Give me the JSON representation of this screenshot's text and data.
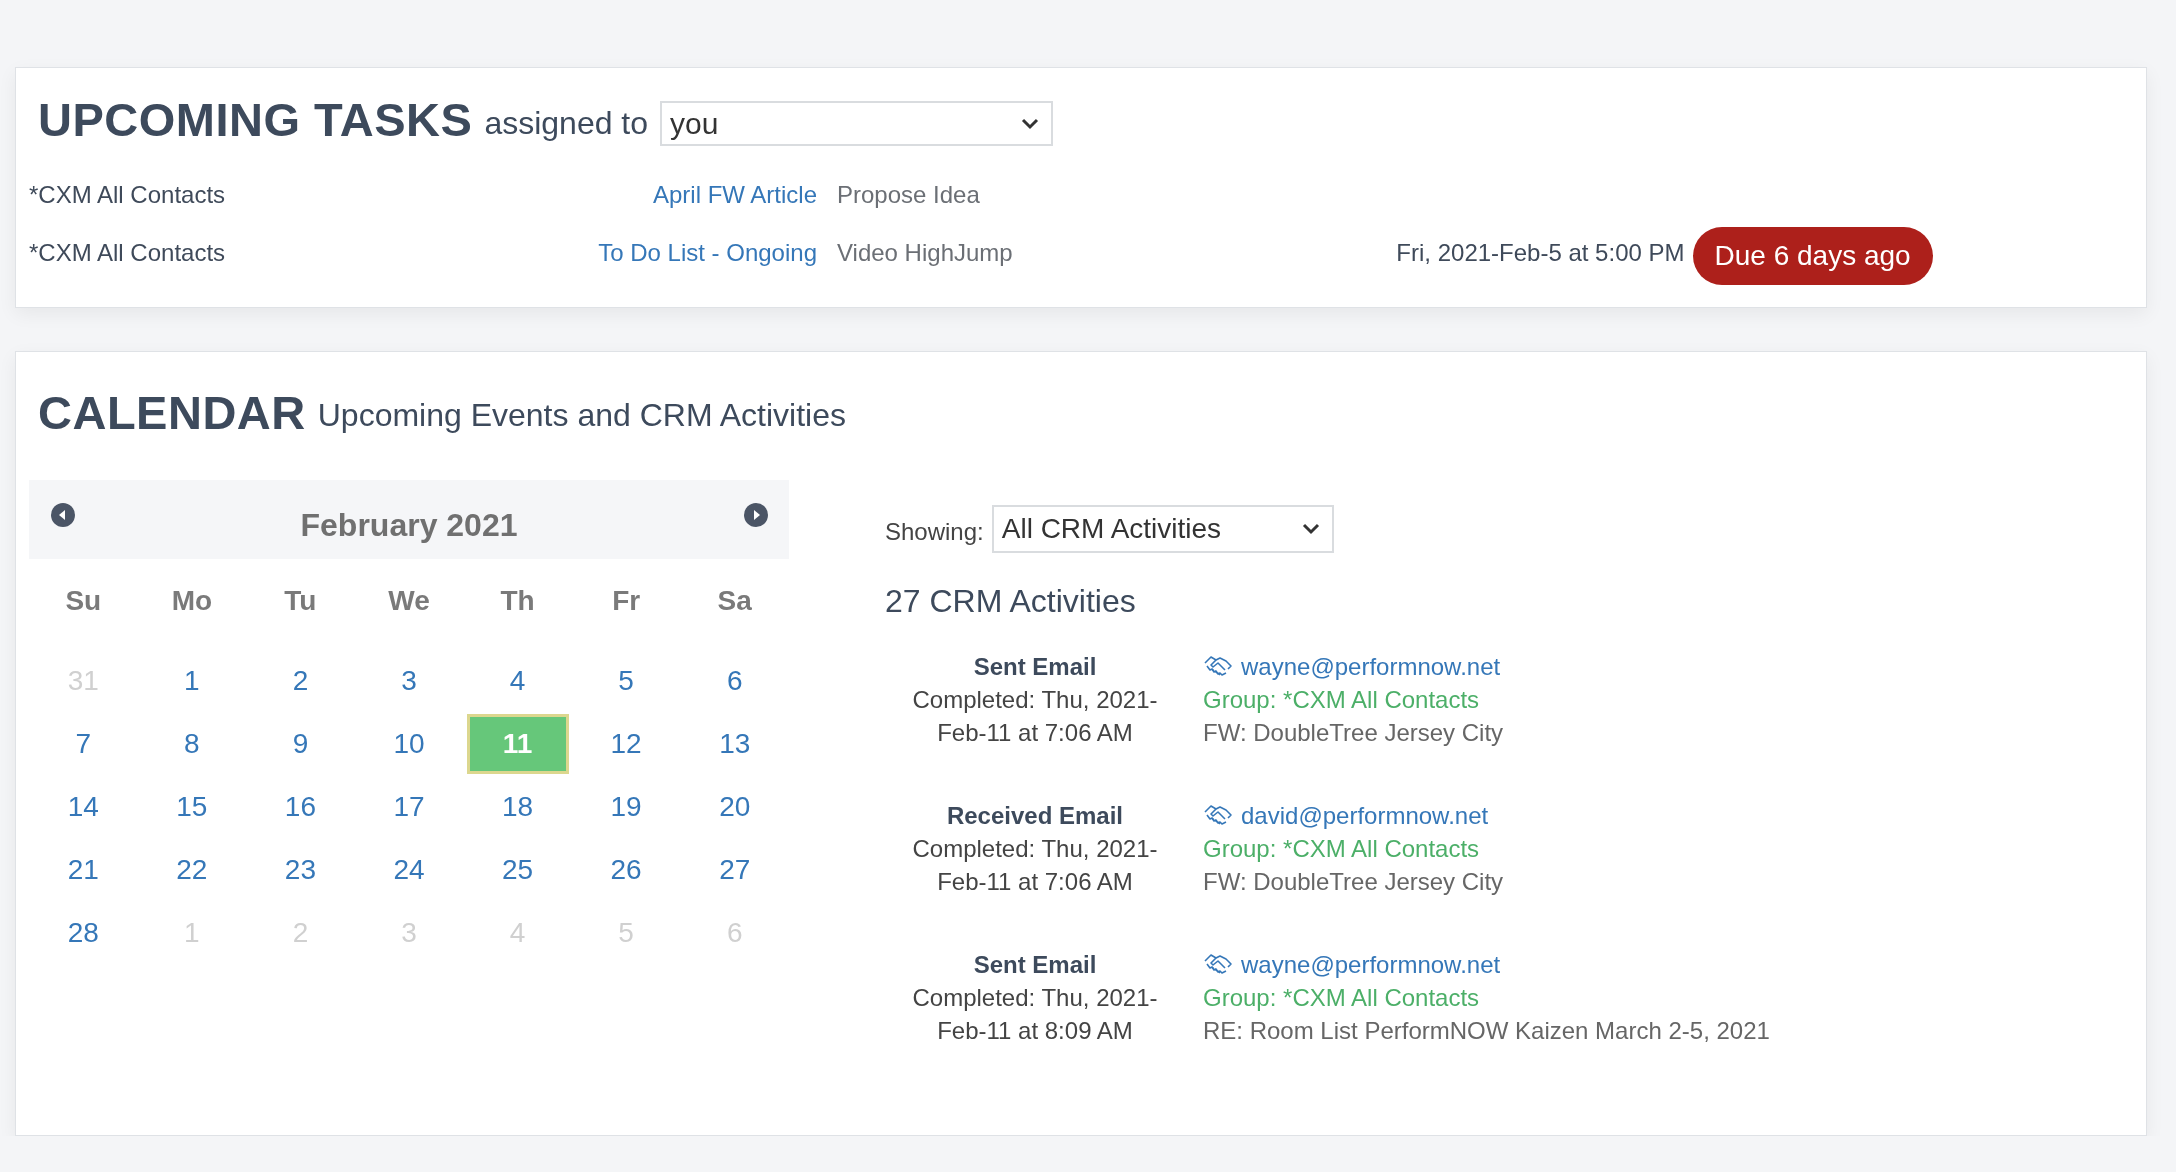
{
  "tasks": {
    "title": "UPCOMING TASKS",
    "subtitle": "assigned to",
    "assignee_select": {
      "value": "you"
    },
    "rows": [
      {
        "group": "*CXM All Contacts",
        "task": "April FW Article",
        "description": "Propose Idea"
      },
      {
        "group": "*CXM All Contacts",
        "task": "To Do List - Ongoing",
        "description": "Video HighJump",
        "due_date": "Fri, 2021-Feb-5 at 5:00 PM",
        "badge": "Due 6 days ago"
      }
    ]
  },
  "calendar": {
    "title": "CALENDAR",
    "subtitle": "Upcoming Events and CRM Activities",
    "month": "February 2021",
    "weekdays": [
      "Su",
      "Mo",
      "Tu",
      "We",
      "Th",
      "Fr",
      "Sa"
    ],
    "weeks": [
      [
        {
          "day": "31",
          "in_month": false,
          "selected": false
        },
        {
          "day": "1",
          "in_month": true,
          "selected": false
        },
        {
          "day": "2",
          "in_month": true,
          "selected": false
        },
        {
          "day": "3",
          "in_month": true,
          "selected": false
        },
        {
          "day": "4",
          "in_month": true,
          "selected": false
        },
        {
          "day": "5",
          "in_month": true,
          "selected": false
        },
        {
          "day": "6",
          "in_month": true,
          "selected": false
        }
      ],
      [
        {
          "day": "7",
          "in_month": true,
          "selected": false
        },
        {
          "day": "8",
          "in_month": true,
          "selected": false
        },
        {
          "day": "9",
          "in_month": true,
          "selected": false
        },
        {
          "day": "10",
          "in_month": true,
          "selected": false
        },
        {
          "day": "11",
          "in_month": true,
          "selected": true
        },
        {
          "day": "12",
          "in_month": true,
          "selected": false
        },
        {
          "day": "13",
          "in_month": true,
          "selected": false
        }
      ],
      [
        {
          "day": "14",
          "in_month": true,
          "selected": false
        },
        {
          "day": "15",
          "in_month": true,
          "selected": false
        },
        {
          "day": "16",
          "in_month": true,
          "selected": false
        },
        {
          "day": "17",
          "in_month": true,
          "selected": false
        },
        {
          "day": "18",
          "in_month": true,
          "selected": false
        },
        {
          "day": "19",
          "in_month": true,
          "selected": false
        },
        {
          "day": "20",
          "in_month": true,
          "selected": false
        }
      ],
      [
        {
          "day": "21",
          "in_month": true,
          "selected": false
        },
        {
          "day": "22",
          "in_month": true,
          "selected": false
        },
        {
          "day": "23",
          "in_month": true,
          "selected": false
        },
        {
          "day": "24",
          "in_month": true,
          "selected": false
        },
        {
          "day": "25",
          "in_month": true,
          "selected": false
        },
        {
          "day": "26",
          "in_month": true,
          "selected": false
        },
        {
          "day": "27",
          "in_month": true,
          "selected": false
        }
      ],
      [
        {
          "day": "28",
          "in_month": true,
          "selected": false
        },
        {
          "day": "1",
          "in_month": false,
          "selected": false
        },
        {
          "day": "2",
          "in_month": false,
          "selected": false
        },
        {
          "day": "3",
          "in_month": false,
          "selected": false
        },
        {
          "day": "4",
          "in_month": false,
          "selected": false
        },
        {
          "day": "5",
          "in_month": false,
          "selected": false
        },
        {
          "day": "6",
          "in_month": false,
          "selected": false
        }
      ]
    ],
    "showing_label": "Showing:",
    "showing_select": {
      "value": "All CRM Activities"
    },
    "count": "27 CRM Activities",
    "activities": [
      {
        "type": "Sent Email",
        "completed": "Completed: Thu, 2021-Feb-11 at 7:06 AM",
        "email": "wayne@performnow.net",
        "group": "Group: *CXM All Contacts",
        "subject": "FW: DoubleTree Jersey City"
      },
      {
        "type": "Received Email",
        "completed": "Completed: Thu, 2021-Feb-11 at 7:06 AM",
        "email": "david@performnow.net",
        "group": "Group: *CXM All Contacts",
        "subject": "FW: DoubleTree Jersey City"
      },
      {
        "type": "Sent Email",
        "completed": "Completed: Thu, 2021-Feb-11 at 8:09 AM",
        "email": "wayne@performnow.net",
        "group": "Group: *CXM All Contacts",
        "subject": "RE: Room List PerformNOW Kaizen March 2-5, 2021"
      }
    ]
  }
}
